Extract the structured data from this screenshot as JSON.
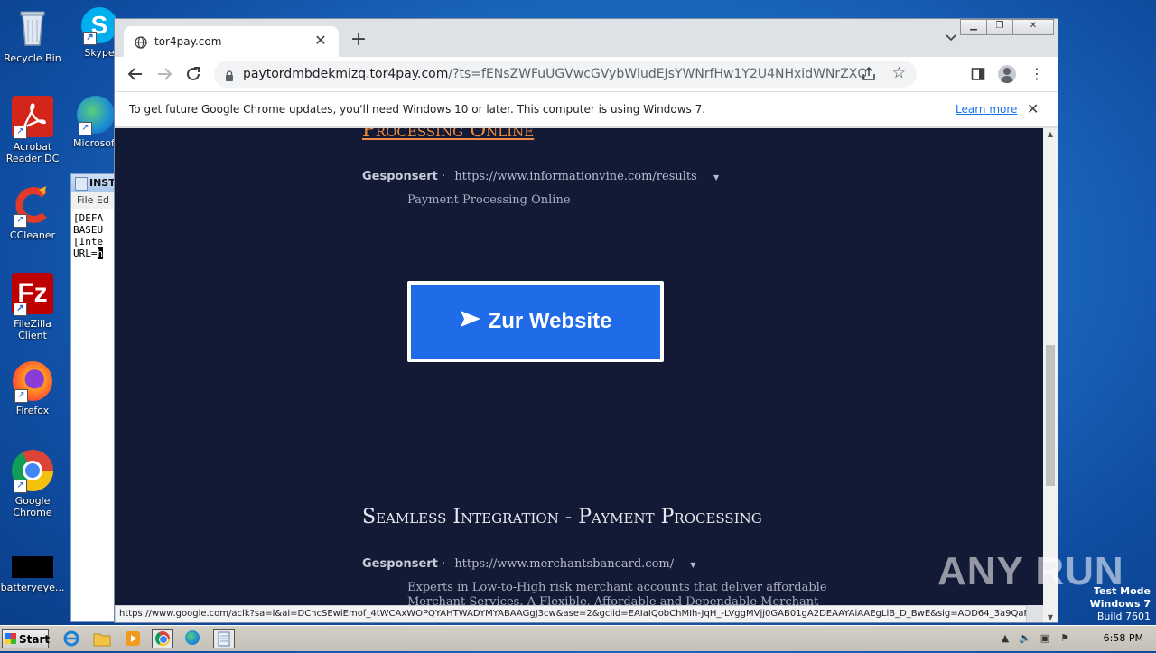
{
  "desktop": {
    "icons": [
      {
        "label": "Recycle Bin"
      },
      {
        "label": "Skype"
      },
      {
        "label": "Acrobat Reader DC"
      },
      {
        "label": "Microsoft"
      },
      {
        "label": "CCleaner"
      },
      {
        "label": "FileZilla Client"
      },
      {
        "label": "Firefox"
      },
      {
        "label": "Google Chrome"
      },
      {
        "label": "batteryeye..."
      }
    ]
  },
  "notepad": {
    "title": "INST",
    "menu": "File  Ed",
    "lines": [
      "[DEFA",
      "BASEU",
      "[Inte",
      "URL="
    ],
    "selection": "h"
  },
  "browser": {
    "tab_title": "tor4pay.com",
    "url_host": "paytordmbdekmizq.tor4pay.com",
    "url_rest": "/?ts=fENsZWFuUGVwcGVybWludEJsYWNrfHw1Y2U4NHxidWNrZXQwMDMsYnVja2...",
    "infobar_message": "To get future Google Chrome updates, you'll need Windows 10 or later. This computer is using Windows 7.",
    "infobar_link": "Learn more",
    "status_url": "https://www.google.com/aclk?sa=l&ai=DChcSEwiEmof_4tWCAxWOPQYAHTWADYMYABAAGgJ3cw&ase=2&gclid=EAIaIQobChMIh-JqH_-LVggMVjj0GAB01gA2DEAAYAiAAEgLlB_D_BwE&sig=AOD64_3a9QaFkn..."
  },
  "page": {
    "ad1": {
      "title": "Processing Online",
      "sponsor_label": "Gesponsert",
      "sponsor_url": "https://www.informationvine.com/results",
      "description": "Payment Processing Online"
    },
    "cta_label": "Zur Website",
    "ad2": {
      "title": "Seamless Integration - Payment Processing",
      "sponsor_label": "Gesponsert",
      "sponsor_url": "https://www.merchantsbancard.com/",
      "description_line1": "Experts in Low-to-High risk merchant accounts that deliver affordable",
      "description_line2": "Merchant Services. A Flexible, Affordable and Dependable Merchant"
    }
  },
  "watermark": {
    "text": "ANY RUN",
    "mode_line1": "Test Mode",
    "mode_line2": "Windows 7",
    "mode_line3": "Build 7601"
  },
  "taskbar": {
    "start_label": "Start",
    "time": "6:58 PM"
  },
  "colors": {
    "page_bg": "#121a35",
    "cta_blue": "#1f6be8",
    "ad_title_orange": "#f08a3c"
  }
}
